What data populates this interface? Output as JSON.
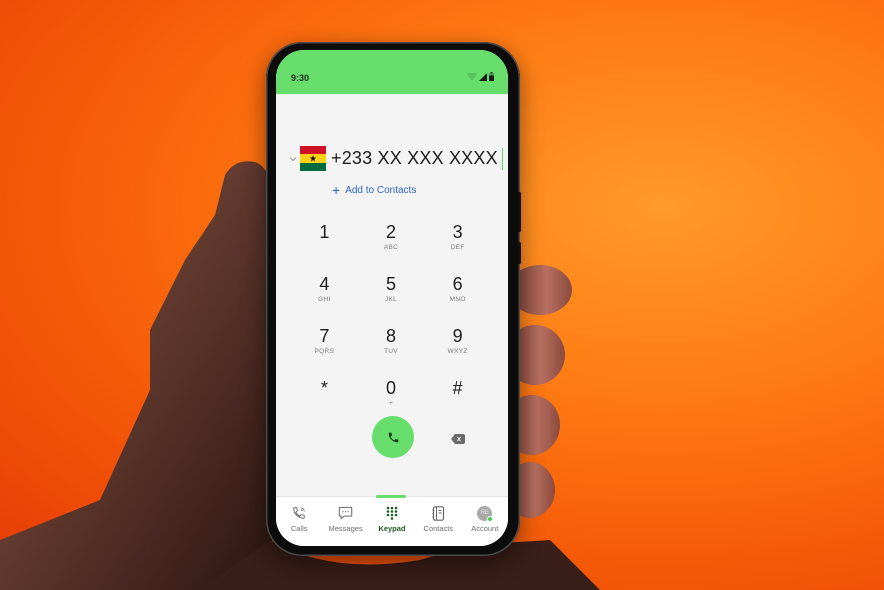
{
  "status_bar": {
    "time": "9:30",
    "icons": [
      "wifi-icon",
      "signal-icon",
      "battery-icon"
    ]
  },
  "dialer": {
    "country_flag": "ghana-flag",
    "number_display": "+233 XX XXX XXXX",
    "add_to_contacts_label": "Add to Contacts",
    "keys": [
      {
        "digit": "1",
        "letters": ""
      },
      {
        "digit": "2",
        "letters": "ABC"
      },
      {
        "digit": "3",
        "letters": "DEF"
      },
      {
        "digit": "4",
        "letters": "GHI"
      },
      {
        "digit": "5",
        "letters": "JKL"
      },
      {
        "digit": "6",
        "letters": "MNO"
      },
      {
        "digit": "7",
        "letters": "PQRS"
      },
      {
        "digit": "8",
        "letters": "TUV"
      },
      {
        "digit": "9",
        "letters": "WXYZ"
      },
      {
        "digit": "*",
        "letters": ""
      },
      {
        "digit": "0",
        "letters": "+"
      },
      {
        "digit": "#",
        "letters": ""
      }
    ]
  },
  "tabs": [
    {
      "label": "Calls",
      "icon": "phone-icon",
      "active": false
    },
    {
      "label": "Messages",
      "icon": "message-icon",
      "active": false
    },
    {
      "label": "Keypad",
      "icon": "keypad-icon",
      "active": true
    },
    {
      "label": "Contacts",
      "icon": "contacts-book-icon",
      "active": false
    },
    {
      "label": "Account",
      "icon": "avatar",
      "active": false,
      "avatar_initials": "RE"
    }
  ],
  "colors": {
    "accent_green": "#67de6c",
    "link_blue": "#2f64c8",
    "active_tab_text": "#1f5a22",
    "background_orange": "#ff7a12"
  }
}
